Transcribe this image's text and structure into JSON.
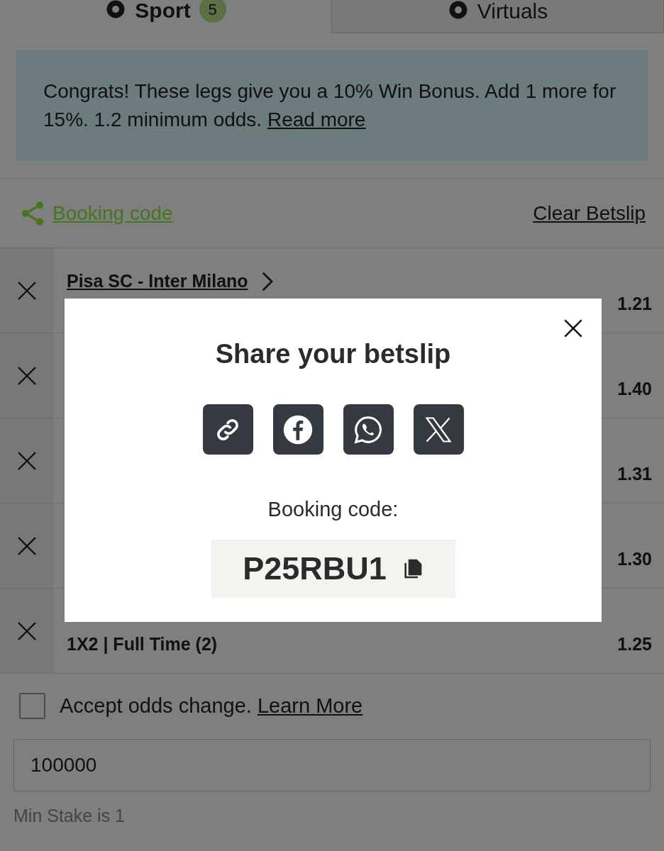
{
  "tabs": [
    {
      "label": "Sport",
      "badge": "5",
      "selected": true
    },
    {
      "label": "Virtuals",
      "selected": false
    }
  ],
  "banner": {
    "text": "Congrats! These legs give you a 10% Win Bonus. Add 1 more for 15%. 1.2 minimum odds.",
    "link": "Read more"
  },
  "booking_link": "Booking code",
  "clear_link": "Clear Betslip",
  "selections": [
    {
      "match": "Pisa SC - Inter Milano",
      "odds": "1.21"
    },
    {
      "odds": "1.40"
    },
    {
      "odds": "1.31"
    },
    {
      "odds": "1.30"
    },
    {
      "market": "1X2 | Full Time (2)",
      "odds": "1.25"
    }
  ],
  "accept_odds": {
    "label": "Accept odds change.",
    "link": "Learn More",
    "checked": false
  },
  "stake": {
    "value": "100000"
  },
  "min_stake": "Min Stake is 1",
  "modal": {
    "title": "Share your betslip",
    "share": [
      {
        "kind": "link"
      },
      {
        "kind": "facebook"
      },
      {
        "kind": "whatsapp"
      },
      {
        "kind": "x"
      }
    ],
    "code_label": "Booking code:",
    "code": "P25RBU1"
  }
}
